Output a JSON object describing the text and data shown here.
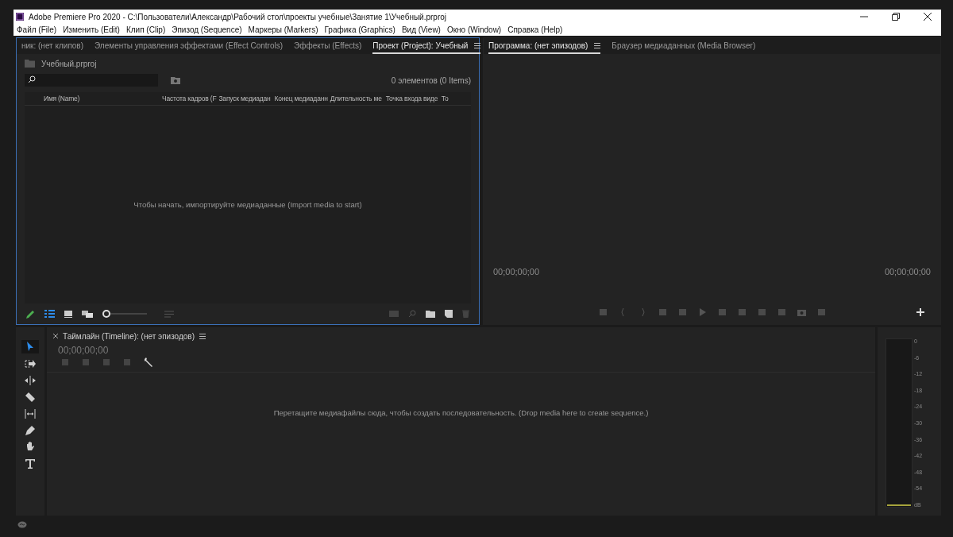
{
  "window": {
    "title": "Adobe Premiere Pro 2020 - C:\\Пользователи\\Александр\\Рабочий стол\\проекты учебные\\Занятие 1\\Учебный.prproj"
  },
  "menu": [
    "Файл (File)",
    "Изменить (Edit)",
    "Клип (Clip)",
    "Эпизод (Sequence)",
    "Маркеры (Markers)",
    "Графика (Graphics)",
    "Вид (View)",
    "Окно (Window)",
    "Справка (Help)"
  ],
  "project_panel": {
    "tabs": [
      {
        "label": "ник: (нет клипов)",
        "selected": false
      },
      {
        "label": "Элементы управления эффектами (Effect Controls)",
        "selected": false
      },
      {
        "label": "Эффекты (Effects)",
        "selected": false
      },
      {
        "label": "Проект (Project): Учебный",
        "selected": true
      }
    ],
    "file_name": "Учебный.prproj",
    "item_count": "0 элементов (0 Items)",
    "columns": [
      "Имя (Name)",
      "Частота кадров (F",
      "Запуск медиадан",
      "Конец медиаданн",
      "Длительность ме",
      "Точка входа виде",
      "То"
    ],
    "empty_message": "Чтобы начать, импортируйте медиаданные (Import media to start)",
    "zoom_slider": {
      "level": 0.0
    }
  },
  "program_monitor": {
    "tabs": [
      {
        "label": "Программа: (нет эпизодов)",
        "selected": true
      },
      {
        "label": "Браузер медиаданных (Media Browser)",
        "selected": false
      }
    ],
    "timecode_in": "00;00;00;00",
    "timecode_out": "00;00;00;00"
  },
  "tools": [
    {
      "kind": "selection",
      "selected": true
    },
    {
      "kind": "track-select",
      "selected": false
    },
    {
      "kind": "ripple",
      "selected": false
    },
    {
      "kind": "razor",
      "selected": false
    },
    {
      "kind": "slip",
      "selected": false
    },
    {
      "kind": "pen",
      "selected": false
    },
    {
      "kind": "hand",
      "selected": false
    },
    {
      "kind": "type",
      "selected": false
    }
  ],
  "timeline": {
    "title": "Таймлайн (Timeline): (нет эпизодов)",
    "timecode": "00;00;00;00",
    "empty_message": "Перетащите медиафайлы сюда, чтобы создать последовательность. (Drop media here to create sequence.)"
  },
  "audio_meter": {
    "scale": [
      "0",
      "-6",
      "-12",
      "-18",
      "-24",
      "-30",
      "-36",
      "-42",
      "-48",
      "-54",
      "dB"
    ]
  }
}
